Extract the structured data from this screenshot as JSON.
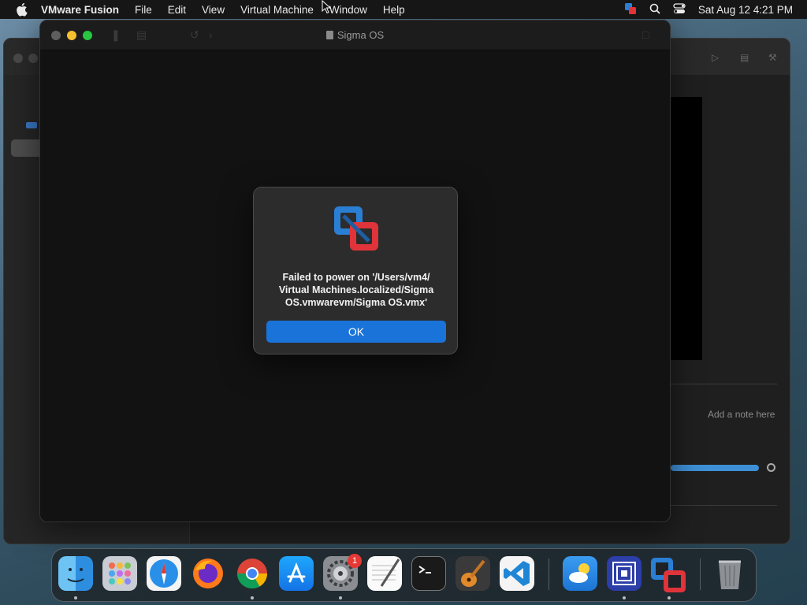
{
  "menubar": {
    "app_name": "VMware Fusion",
    "items": [
      "File",
      "Edit",
      "View",
      "Virtual Machine",
      "Window",
      "Help"
    ],
    "clock": "Sat Aug 12  4:21 PM"
  },
  "window": {
    "title": "Sigma OS"
  },
  "library": {
    "note_placeholder": "Add a note here"
  },
  "dialog": {
    "message_lines": [
      "Failed to power on '/Users/vm4/",
      "Virtual Machines.localized/Sigma",
      "OS.vmwarevm/Sigma OS.vmx'"
    ],
    "ok_label": "OK"
  },
  "dock": {
    "settings_badge": "1",
    "apps": [
      "finder",
      "launchpad",
      "safari",
      "firefox",
      "chrome",
      "app-store",
      "system-preferences",
      "textedit",
      "terminal",
      "garageband",
      "vscode",
      "weather",
      "vmware-fusion-library",
      "vmware-fusion",
      "trash"
    ]
  },
  "colors": {
    "accent": "#1a73d9",
    "dialog_bg": "#2c2c2c",
    "vmware_red": "#e0343a",
    "vmware_blue": "#2a7fd4"
  }
}
